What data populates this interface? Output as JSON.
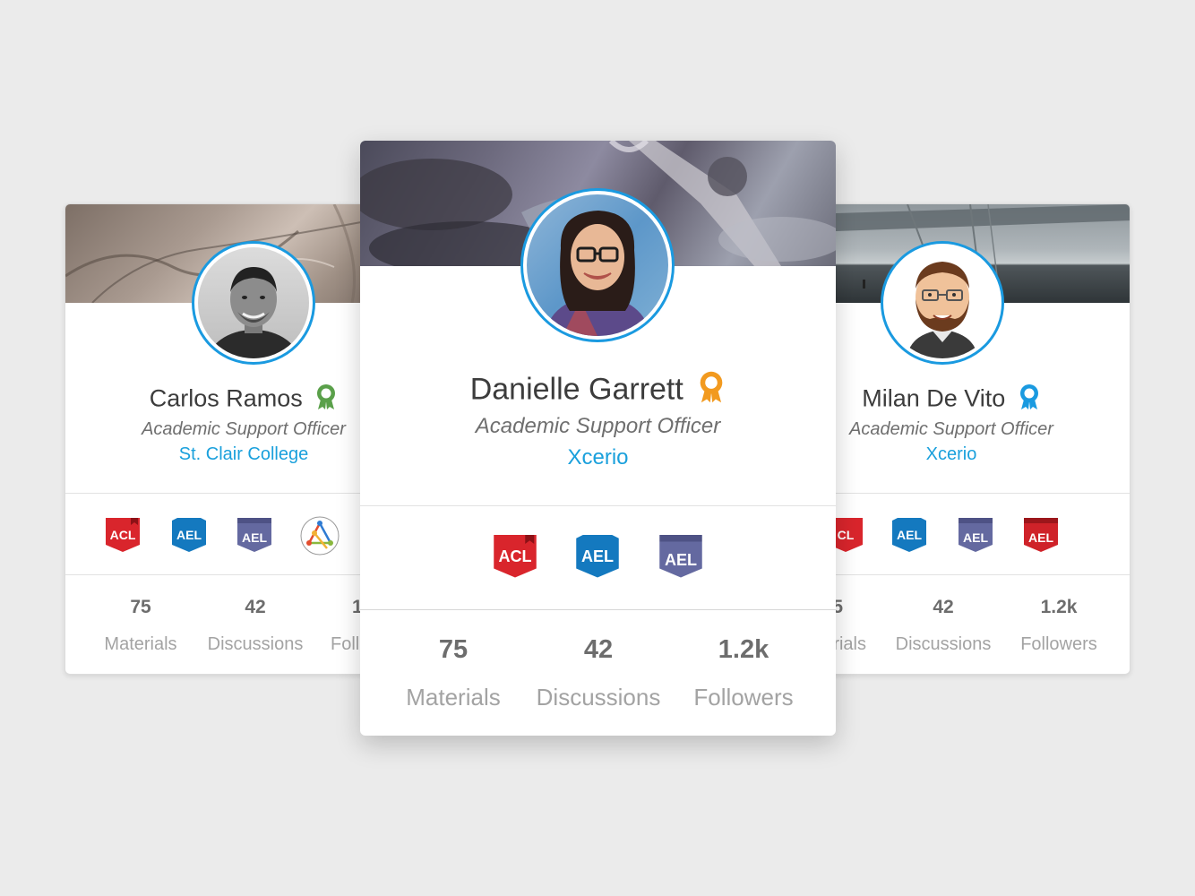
{
  "cards": {
    "left": {
      "name": "Carlos Ramos",
      "role": "Academic Support Officer",
      "org": "St. Clair College",
      "award_color": "#5aa04a",
      "badges": [
        "ACL",
        "AEL",
        "AEL",
        "network-logo"
      ],
      "stats": [
        {
          "value": "75",
          "label": "Materials"
        },
        {
          "value": "42",
          "label": "Discussions"
        },
        {
          "value": "1",
          "label": "Foll"
        }
      ]
    },
    "center": {
      "name": "Danielle Garrett",
      "role": "Academic Support Officer",
      "org": "Xcerio",
      "award_color": "#f29a1f",
      "badges": [
        "ACL",
        "AEL",
        "AEL"
      ],
      "stats": [
        {
          "value": "75",
          "label": "Materials"
        },
        {
          "value": "42",
          "label": "Discussions"
        },
        {
          "value": "1.2k",
          "label": "Followers"
        }
      ]
    },
    "right": {
      "name": "Milan De Vito",
      "role": "Academic Support Officer",
      "org": "Xcerio",
      "award_color": "#1a9ae0",
      "badges": [
        "CL",
        "AEL",
        "AEL",
        "AEL"
      ],
      "stats": [
        {
          "value": "5",
          "label": "rials"
        },
        {
          "value": "42",
          "label": "Discussions"
        },
        {
          "value": "1.2k",
          "label": "Followers"
        }
      ]
    }
  },
  "badge_colors": {
    "acl": "#d9252c",
    "ael_blue": "#1479bf",
    "ael_purple": "#6469a0",
    "ael_red": "#cf2229"
  },
  "accent": "#1a9ae0"
}
